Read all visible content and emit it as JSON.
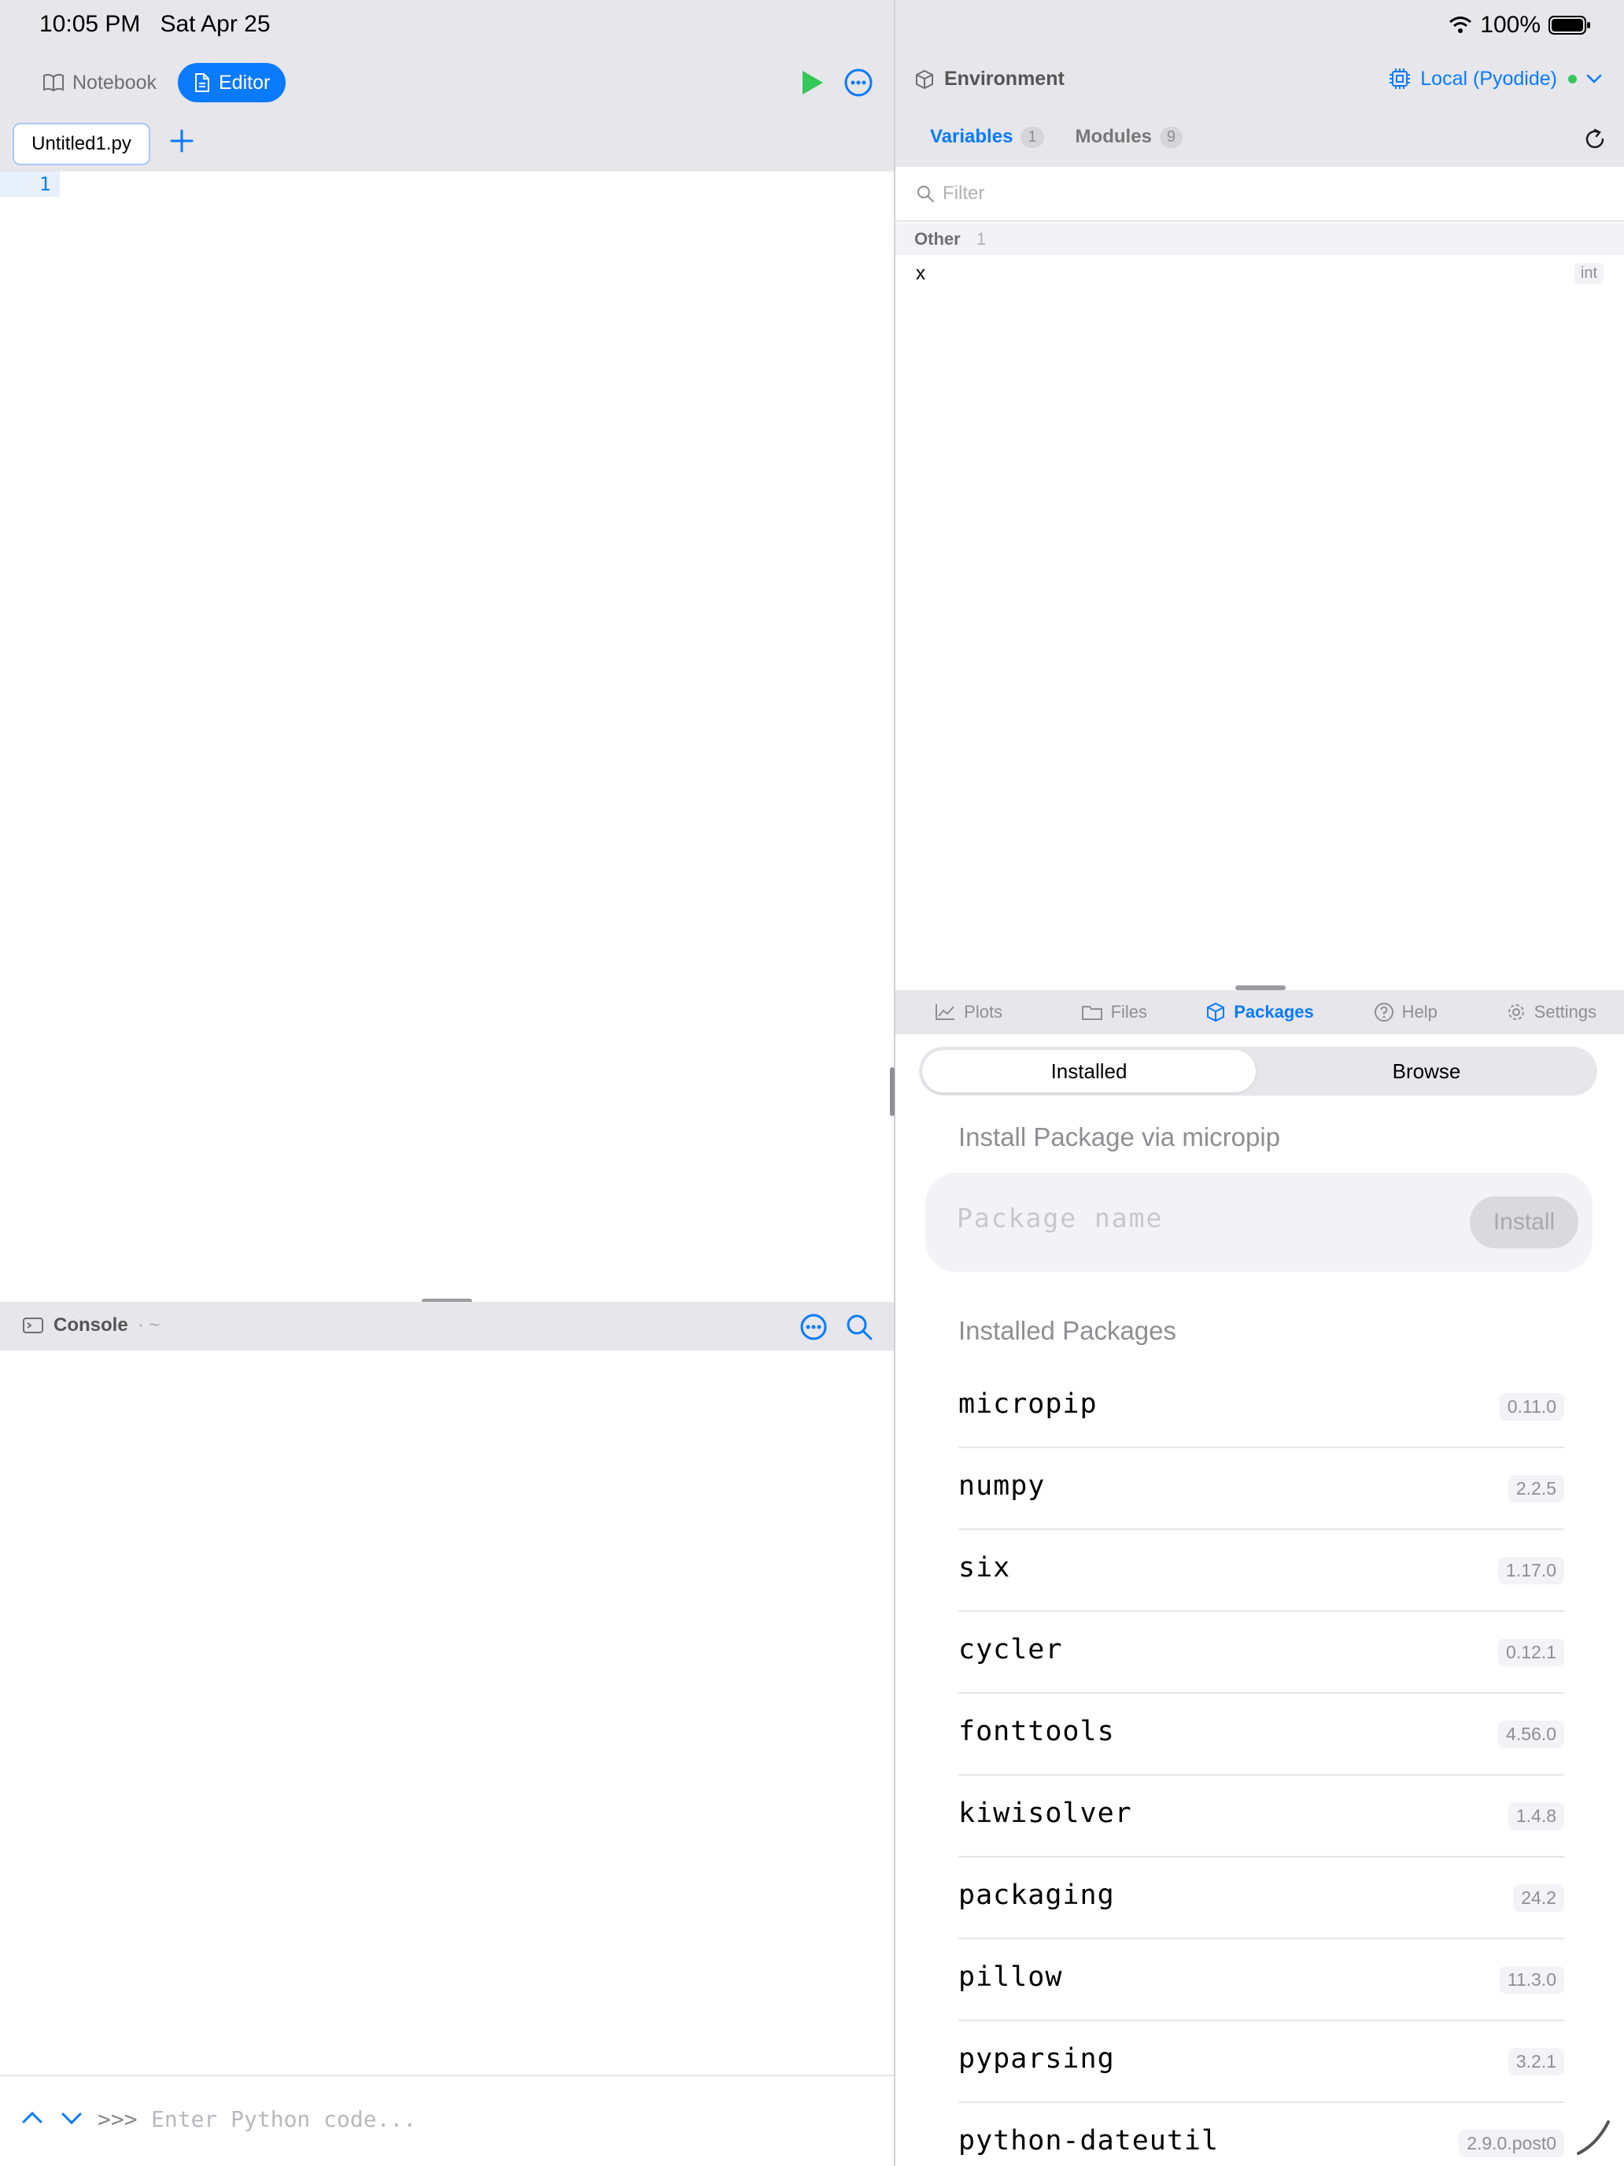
{
  "status": {
    "time": "10:05 PM",
    "date": "Sat Apr 25",
    "battery": "100%"
  },
  "left_toolbar": {
    "notebook_label": "Notebook",
    "editor_label": "Editor"
  },
  "tabs": {
    "file": "Untitled1.py"
  },
  "editor": {
    "line_number": "1"
  },
  "console": {
    "title": "Console",
    "subtitle": "· ~",
    "prompt": ">>>",
    "placeholder": "Enter Python code..."
  },
  "environment": {
    "title": "Environment",
    "runtime": "Local (Pyodide)",
    "tabs": [
      {
        "label": "Variables",
        "count": "1"
      },
      {
        "label": "Modules",
        "count": "9"
      }
    ],
    "filter_placeholder": "Filter",
    "group": {
      "label": "Other",
      "count": "1"
    },
    "variable": {
      "name": "x",
      "type": "int"
    }
  },
  "bottom_tabs": [
    "Plots",
    "Files",
    "Packages",
    "Help",
    "Settings"
  ],
  "packages": {
    "segments": {
      "installed": "Installed",
      "browse": "Browse"
    },
    "install_title": "Install Package via micropip",
    "input_placeholder": "Package name",
    "install_button": "Install",
    "installed_title": "Installed Packages",
    "list": [
      {
        "name": "micropip",
        "version": "0.11.0"
      },
      {
        "name": "numpy",
        "version": "2.2.5"
      },
      {
        "name": "six",
        "version": "1.17.0"
      },
      {
        "name": "cycler",
        "version": "0.12.1"
      },
      {
        "name": "fonttools",
        "version": "4.56.0"
      },
      {
        "name": "kiwisolver",
        "version": "1.4.8"
      },
      {
        "name": "packaging",
        "version": "24.2"
      },
      {
        "name": "pillow",
        "version": "11.3.0"
      },
      {
        "name": "pyparsing",
        "version": "3.2.1"
      },
      {
        "name": "python-dateutil",
        "version": "2.9.0.post0"
      }
    ]
  },
  "colors": {
    "accent": "#0a7aff",
    "run": "#34c759",
    "chrome": "#e6e6eb"
  }
}
